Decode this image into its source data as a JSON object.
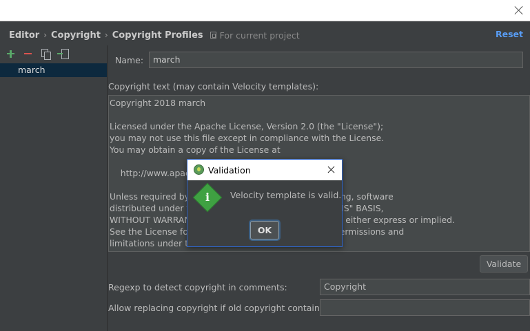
{
  "breadcrumb": {
    "items": [
      "Editor",
      "Copyright",
      "Copyright Profiles"
    ],
    "scope": "For current project",
    "reset": "Reset"
  },
  "profiles": [
    "march"
  ],
  "form": {
    "name_label": "Name:",
    "name_value": "march",
    "copyright_label": "Copyright text (may contain Velocity templates):",
    "copyright_lines": [
      "Copyright 2018 march",
      "",
      "Licensed under the Apache License, Version 2.0 (the \"License\");",
      "you may not use this file except in compliance with the License.",
      "You may obtain a copy of the License at",
      "",
      "    http://www.apache.org/licenses/LICENSE-2.0",
      "",
      "Unless required by applicable law or agreed to in writing, software",
      "distributed under the License is distributed on an \"AS IS\" BASIS,",
      "WITHOUT WARRANTIES OR CONDITIONS OF ANY KIND, either express or implied.",
      "See the License for the specific language governing permissions and",
      "limitations under the License."
    ],
    "validate_label": "Validate",
    "regexp_label": "Regexp to detect copyright in comments:",
    "regexp_value": "Copyright",
    "allow_label": "Allow replacing copyright if old copyright contains:",
    "allow_value": ""
  },
  "dialog": {
    "title": "Validation",
    "message": "Velocity template is valid.",
    "ok_label": "OK",
    "icon": "info-icon"
  },
  "colors": {
    "background": "#3c3f41",
    "accent": "#589df6",
    "selected": "#0d293e",
    "dialog_border": "#2f65ca"
  }
}
